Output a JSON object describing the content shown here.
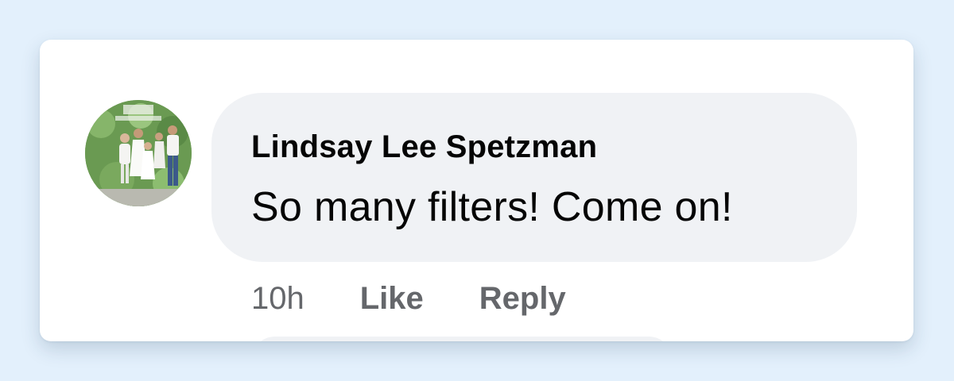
{
  "comment": {
    "author": "Lindsay Lee Spetzman",
    "text": "So many filters! Come on!",
    "timestamp": "10h",
    "actions": {
      "like_label": "Like",
      "reply_label": "Reply"
    },
    "avatar_icon": "profile-photo-icon"
  },
  "colors": {
    "page_background": "#e3f0fc",
    "card_background": "#ffffff",
    "bubble_background": "#f0f2f5",
    "primary_text": "#050505",
    "secondary_text": "#65676b"
  }
}
